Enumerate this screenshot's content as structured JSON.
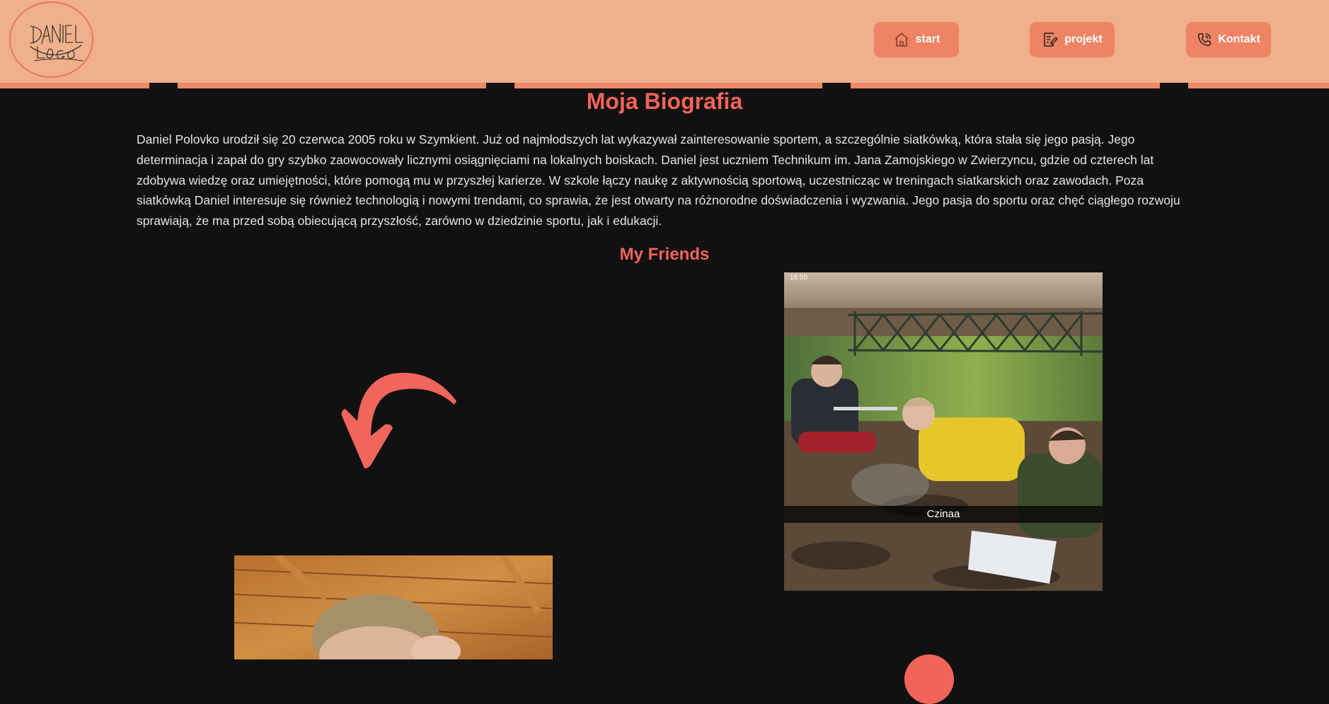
{
  "header": {
    "logo": {
      "text": "DANIEL LOGO",
      "icon": "handwritten-logo",
      "border_color": "#e6795d"
    },
    "nav": [
      {
        "label": "start",
        "icon": "home-icon"
      },
      {
        "label": "projekt",
        "icon": "document-edit-icon"
      },
      {
        "label": "Kontakt",
        "icon": "phone-icon"
      }
    ],
    "colors": {
      "background": "#efb08b",
      "stripe": "#ee8867",
      "button": "#ee8463"
    }
  },
  "main": {
    "title": "Moja Biografia",
    "bio": "Daniel Polovko urodził się 20 czerwca 2005 roku w Szymkient. Już od najmłodszych lat wykazywał zainteresowanie sportem, a szczególnie siatkówką, która stała się jego pasją. Jego determinacja i zapał do gry szybko zaowocowały licznymi osiągnięciami na lokalnych boiskach. Daniel jest uczniem Technikum im. Jana Zamojskiego w Zwierzyncu, gdzie od czterech lat zdobywa wiedzę oraz umiejętności, które pomogą mu w przyszłej karierze. W szkole łączy naukę z aktywnością sportową, uczestnicząc w treningach siatkarskich oraz zawodach. Poza siatkówką Daniel interesuje się również technologią i nowymi trendami, co sprawia, że jest otwarty na różnorodne doświadczenia i wyzwania. Jego pasja do sportu oraz chęć ciągłego rozwoju sprawiają, że ma przed sobą obiecującą przyszłość, zarówno w dziedzinie sportu, jak i edukacji.",
    "friends_title": "My Friends",
    "friends_photo": {
      "status_time": "16:50",
      "caption": "Czinaa"
    },
    "arrow_icon": "curved-arrow-icon",
    "colors": {
      "accent": "#f2645a",
      "text": "#e5e5e5",
      "background": "#111111"
    }
  }
}
